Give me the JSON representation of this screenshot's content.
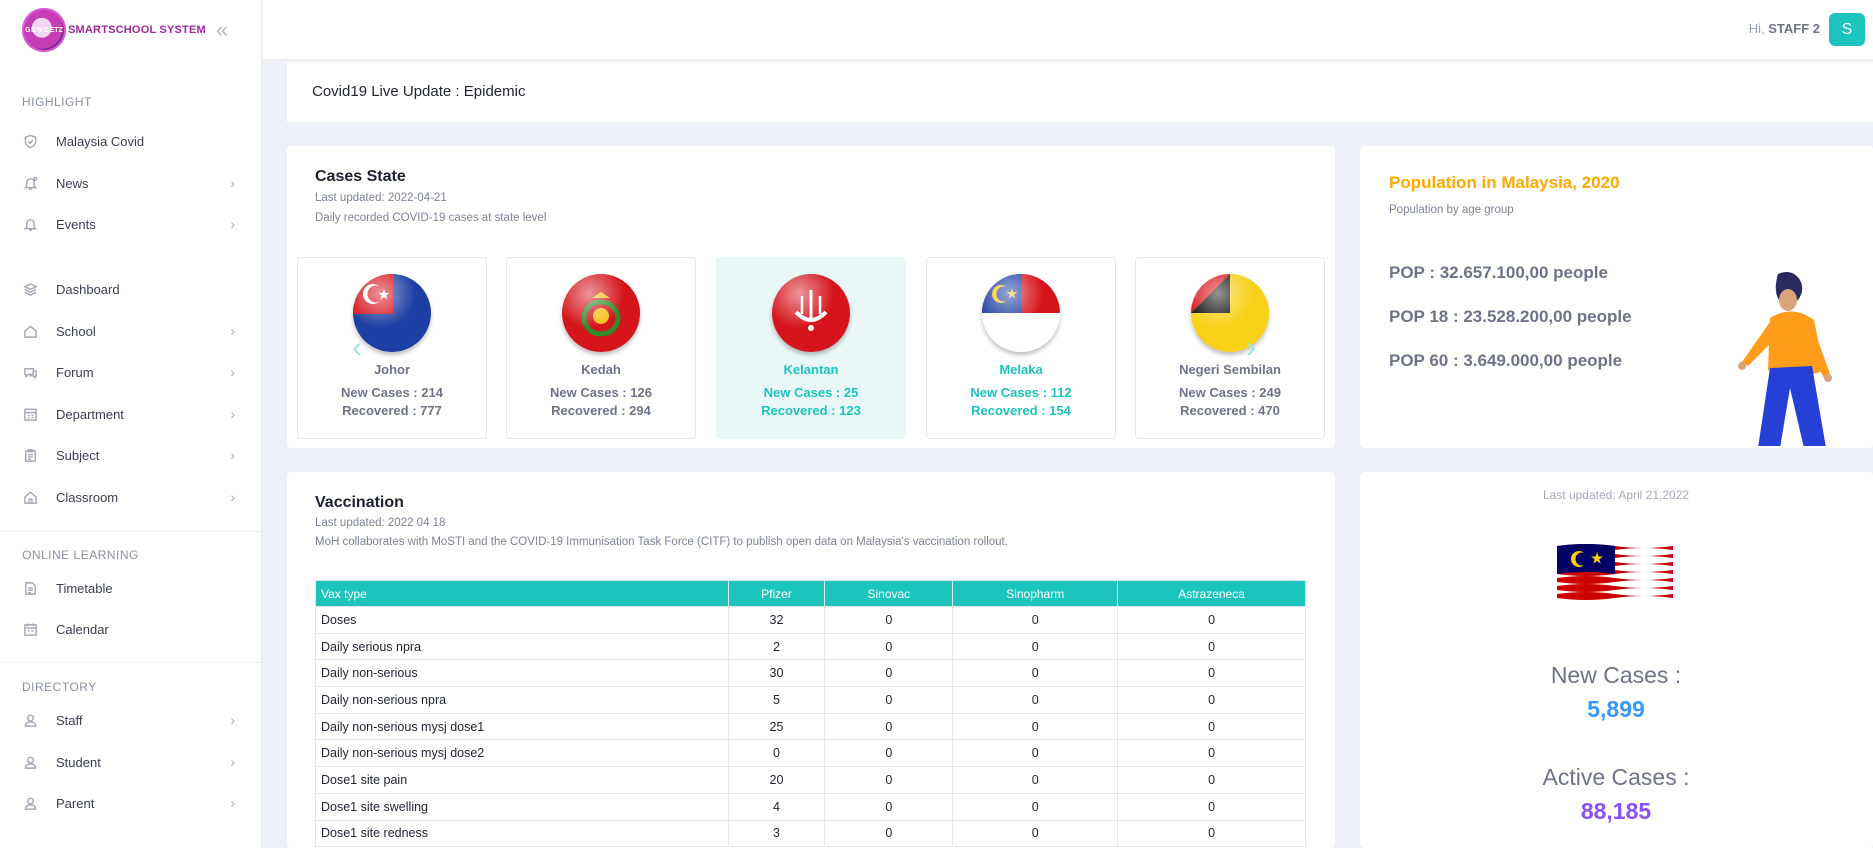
{
  "app": {
    "name": "SMARTSCHOOL SYSTEM",
    "logo_text": "GS N GETZ"
  },
  "colors": {
    "accent": "#1bc5bd",
    "brand": "#a4269d",
    "orange": "#ffa800",
    "blue": "#3699ff",
    "purple": "#8950fc"
  },
  "sidebar": {
    "sections": [
      {
        "title": "HIGHLIGHT"
      },
      {
        "title": "ONLINE LEARNING"
      },
      {
        "title": "DIRECTORY"
      }
    ],
    "items": [
      {
        "label": "Malaysia Covid",
        "icon": "shield-icon",
        "has_arrow": false
      },
      {
        "label": "News",
        "icon": "bell-icon",
        "has_arrow": true
      },
      {
        "label": "Events",
        "icon": "bell-icon",
        "has_arrow": true
      },
      {
        "label": "Dashboard",
        "icon": "layers-icon",
        "has_arrow": false
      },
      {
        "label": "School",
        "icon": "home-icon",
        "has_arrow": true
      },
      {
        "label": "Forum",
        "icon": "chat-icon",
        "has_arrow": true
      },
      {
        "label": "Department",
        "icon": "building-icon",
        "has_arrow": true
      },
      {
        "label": "Subject",
        "icon": "clipboard-icon",
        "has_arrow": true
      },
      {
        "label": "Classroom",
        "icon": "home-icon",
        "has_arrow": true
      },
      {
        "label": "Timetable",
        "icon": "document-icon",
        "has_arrow": false
      },
      {
        "label": "Calendar",
        "icon": "calendar-icon",
        "has_arrow": false
      },
      {
        "label": "Staff",
        "icon": "user-icon",
        "has_arrow": true
      },
      {
        "label": "Student",
        "icon": "user-icon",
        "has_arrow": true
      },
      {
        "label": "Parent",
        "icon": "user-icon",
        "has_arrow": true
      }
    ]
  },
  "header": {
    "greeting": "Hi,",
    "user": "STAFF 2",
    "avatar_letter": "S"
  },
  "subheader": {
    "title": "Covid19 Live Update : Epidemic"
  },
  "cases_state": {
    "title": "Cases State",
    "updated": "Last updated: 2022-04-21",
    "description": "Daily recorded COVID-19 cases at state level",
    "states": [
      {
        "name": "Johor",
        "new_cases": "New Cases : 214",
        "recovered": "Recovered : 777"
      },
      {
        "name": "Kedah",
        "new_cases": "New Cases : 126",
        "recovered": "Recovered : 294"
      },
      {
        "name": "Kelantan",
        "new_cases": "New Cases : 25",
        "recovered": "Recovered : 123"
      },
      {
        "name": "Melaka",
        "new_cases": "New Cases : 112",
        "recovered": "Recovered : 154"
      },
      {
        "name": "Negeri Sembilan",
        "new_cases": "New Cases : 249",
        "recovered": "Recovered : 470"
      }
    ]
  },
  "population": {
    "title": "Population in Malaysia, 2020",
    "subtitle": "Population by age group",
    "lines": [
      "POP : 32.657.100,00 people",
      "POP 18 : 23.528.200,00 people",
      "POP 60 : 3.649.000,00 people"
    ]
  },
  "vaccination": {
    "title": "Vaccination",
    "updated": "Last updated: 2022 04 18",
    "description": "MoH collaborates with MoSTI and the COVID-19 Immunisation Task Force (CITF) to publish open data on Malaysia's vaccination rollout.",
    "columns": [
      "Vax type",
      "Pfizer",
      "Sinovac",
      "Sinopharm",
      "Astrazeneca"
    ],
    "rows": [
      [
        "Doses",
        "32",
        "0",
        "0",
        "0"
      ],
      [
        "Daily serious npra",
        "2",
        "0",
        "0",
        "0"
      ],
      [
        "Daily non-serious",
        "30",
        "0",
        "0",
        "0"
      ],
      [
        "Daily non-serious npra",
        "5",
        "0",
        "0",
        "0"
      ],
      [
        "Daily non-serious mysj dose1",
        "25",
        "0",
        "0",
        "0"
      ],
      [
        "Daily non-serious mysj dose2",
        "0",
        "0",
        "0",
        "0"
      ],
      [
        "Dose1 site pain",
        "20",
        "0",
        "0",
        "0"
      ],
      [
        "Dose1 site swelling",
        "4",
        "0",
        "0",
        "0"
      ],
      [
        "Dose1 site redness",
        "3",
        "0",
        "0",
        "0"
      ]
    ]
  },
  "summary": {
    "updated": "Last updated: April 21,2022",
    "new_cases_label": "New Cases :",
    "new_cases_value": "5,899",
    "active_cases_label": "Active Cases :",
    "active_cases_value": "88,185"
  }
}
